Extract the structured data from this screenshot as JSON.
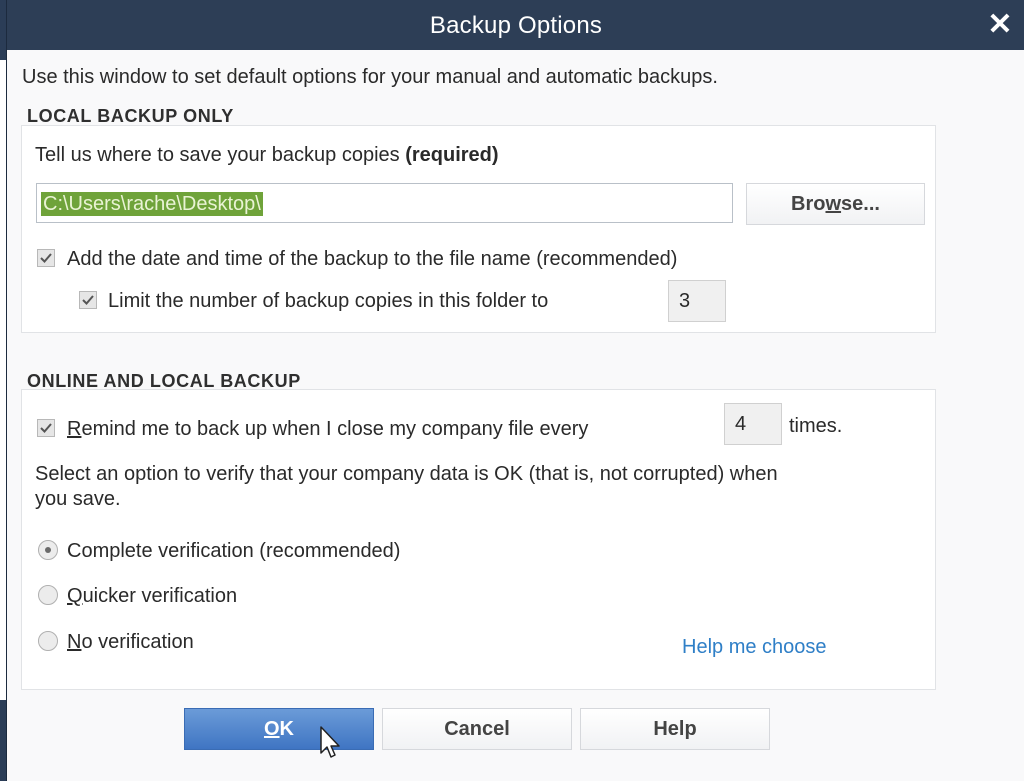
{
  "window": {
    "title": "Backup Options"
  },
  "intro_text": "Use this window to set default options for your manual and automatic backups.",
  "local_backup": {
    "heading": "LOCAL BACKUP ONLY",
    "prompt_text": "Tell us where to save your backup copies ",
    "prompt_required": "(required)",
    "path_value": "C:\\Users\\rache\\Desktop\\",
    "browse_label_a": "Bro",
    "browse_label_u": "w",
    "browse_label_b": "se...",
    "add_date_label": "Add the date and time of the backup to the file name (recommended)",
    "add_date_checked": true,
    "limit_label": "Limit the number of backup copies in this folder to",
    "limit_checked": true,
    "limit_value": "3"
  },
  "online_backup": {
    "heading": "ONLINE AND LOCAL BACKUP",
    "remind_u": "R",
    "remind_label": "emind me to back up when I close my company file every",
    "remind_checked": true,
    "remind_value": "4",
    "times_label": "times.",
    "verify_text_line1": "Select an option to verify that your company data is OK (that is, not corrupted) when",
    "verify_text_line2": "you save.",
    "options": [
      {
        "label": "Complete verification (recommended)",
        "selected": true
      },
      {
        "label_u": "Q",
        "label_rest": "uicker verification",
        "selected": false
      },
      {
        "label_u": "N",
        "label_rest": "o verification",
        "selected": false
      }
    ],
    "help_link": "Help me choose"
  },
  "buttons": {
    "ok_u": "O",
    "ok_rest": "K",
    "cancel": "Cancel",
    "help": "Help"
  },
  "colors": {
    "titlebar": "#2d3e56",
    "primary_button": "#3f75c3",
    "link": "#2f7fc7",
    "selection": "#6fa33a"
  },
  "icons": {
    "close": "close-icon",
    "check": "checkmark-icon",
    "cursor": "mouse-pointer-icon"
  }
}
